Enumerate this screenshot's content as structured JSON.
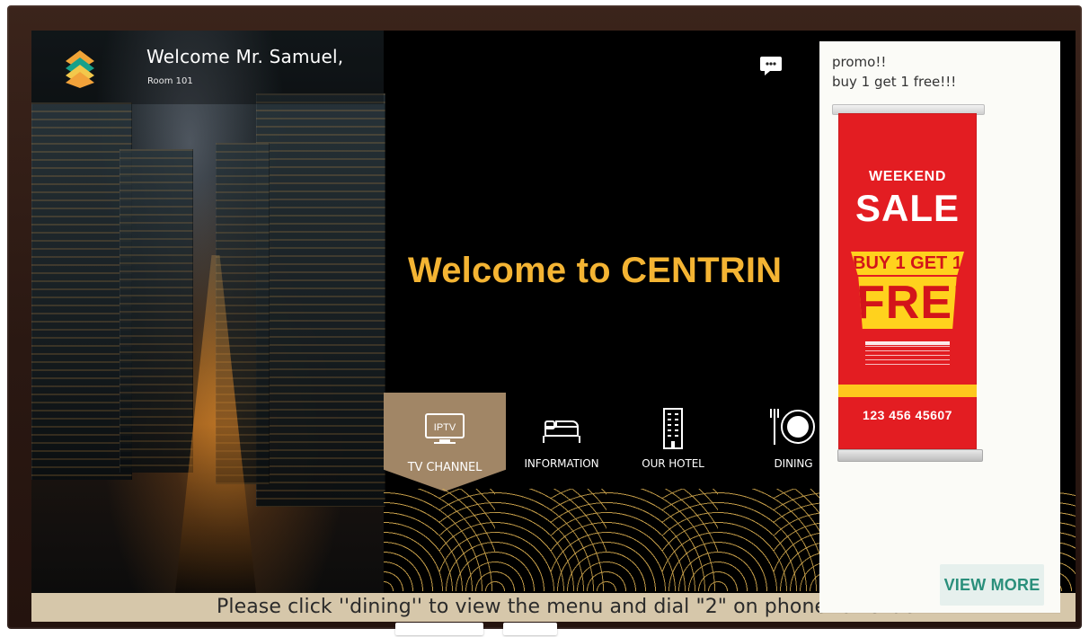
{
  "header": {
    "greeting": "Welcome Mr. Samuel,",
    "room": "Room 101"
  },
  "icons": {
    "brand_logo": "hotel-logo-icon",
    "chat": "chat-bubble-icon",
    "tv": "tv-icon",
    "bed": "bed-icon",
    "building": "building-icon",
    "dining": "dining-icon"
  },
  "main": {
    "welcome_title": "Welcome to CENTRIN"
  },
  "menu": {
    "items": [
      {
        "label": "TV CHANNEL",
        "icon_text": "IPTV"
      },
      {
        "label": "INFORMATION"
      },
      {
        "label": "OUR HOTEL"
      },
      {
        "label": "DINING"
      }
    ]
  },
  "ticker": {
    "text": "Please click ''dining'' to view the menu and dial \"2\" on phone for Order"
  },
  "promo": {
    "line1": "promo!!",
    "line2": "buy 1 get 1 free!!!",
    "banner": {
      "weekend": "WEEKEND",
      "sale": "SALE",
      "buy": "BUY 1 GET 1",
      "free": "FREE",
      "phone": "123 456 45607"
    },
    "view_more": "VIEW MORE"
  },
  "colors": {
    "gold": "#f4b433",
    "menu_active": "#a18666",
    "ticker_bg": "#d6c7aa",
    "promo_bg": "#fbfbf7",
    "view_more_text": "#2a8f7b",
    "banner_red": "#e31d22",
    "banner_yellow": "#ffd21d"
  }
}
